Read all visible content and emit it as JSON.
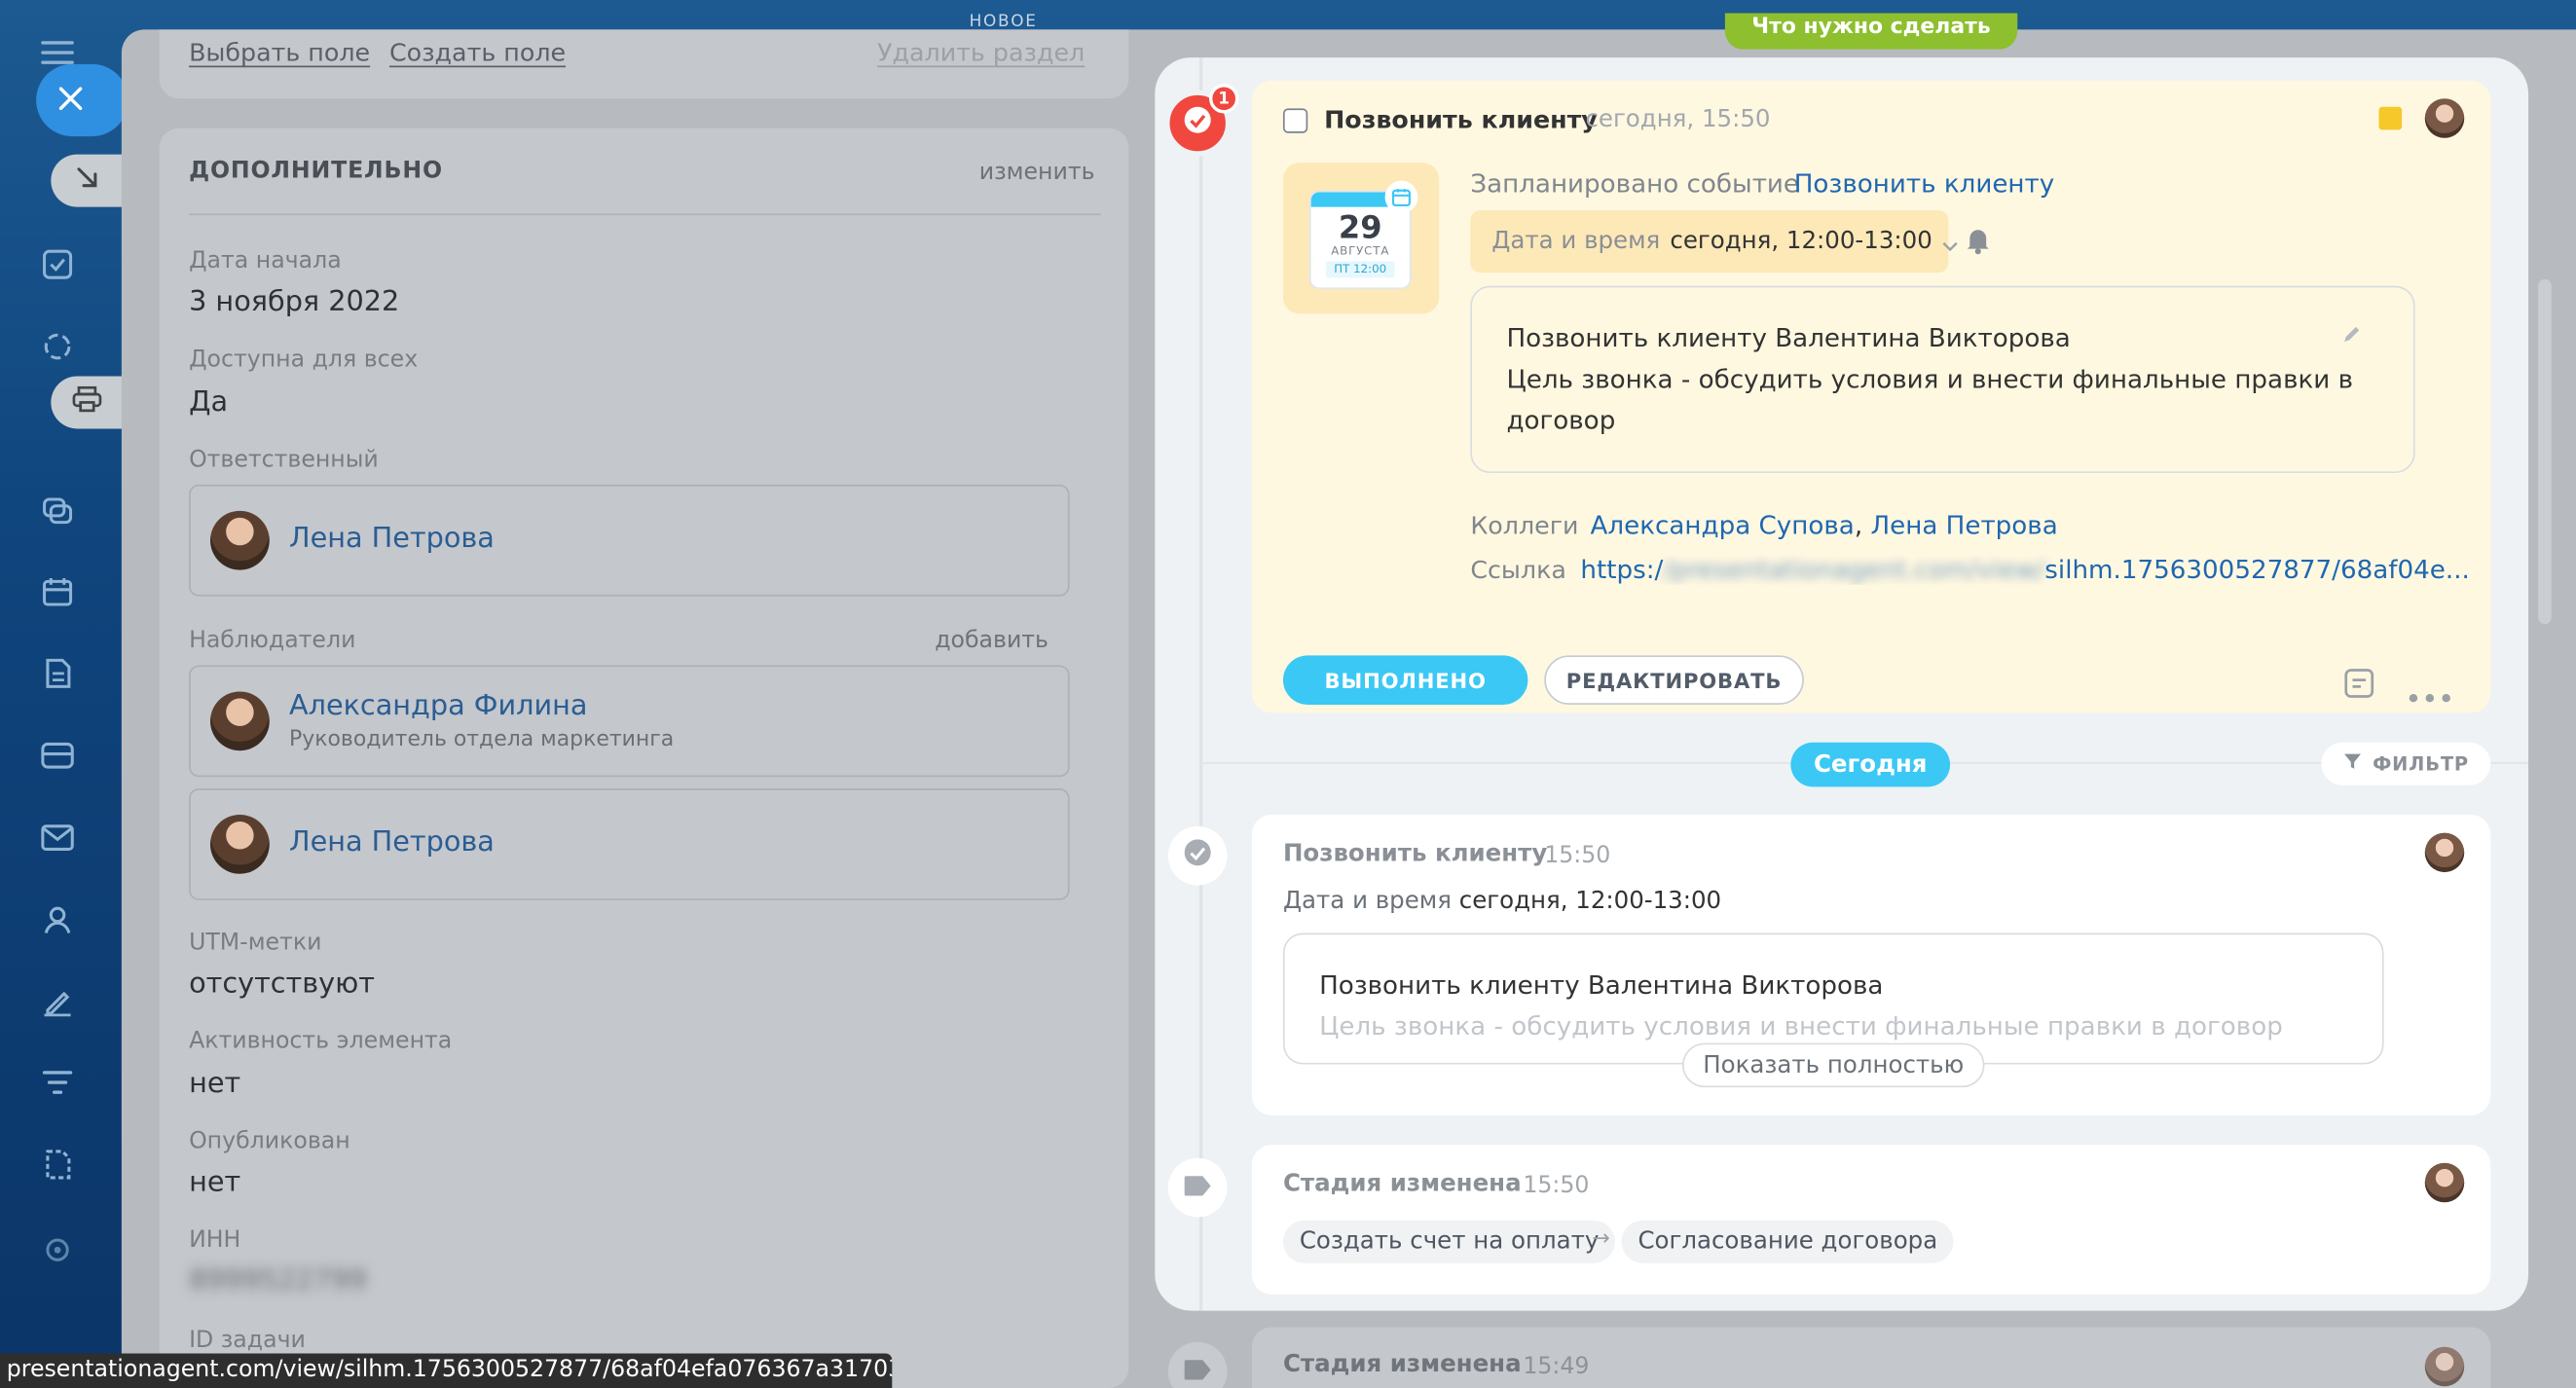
{
  "colors": {
    "accent": "#3bc8f5",
    "link": "#2067b0",
    "todo_pill": "#8dbf2e",
    "yellow_card": "#fff8e1",
    "badge": "#f0483e"
  },
  "top": {
    "new_label": "НОВОЕ",
    "todo_pill": "Что нужно сделать"
  },
  "left": {
    "select_field": "Выбрать поле",
    "create_field": "Создать поле",
    "delete_section": "Удалить раздел",
    "section_title": "ДОПОЛНИТЕЛЬНО",
    "edit_link": "изменить",
    "start_date_label": "Дата начала",
    "start_date_value": "3 ноября 2022",
    "available_label": "Доступна для всех",
    "available_value": "Да",
    "responsible_label": "Ответственный",
    "responsible_name": "Лена Петрова",
    "observers_label": "Наблюдатели",
    "add_link": "добавить",
    "observers": [
      {
        "name": "Александра Филина",
        "role": "Руководитель отдела маркетинга"
      },
      {
        "name": "Лена Петрова",
        "role": ""
      }
    ],
    "utm_label": "UTM-метки",
    "utm_value": "отсутствуют",
    "activity_label": "Активность элемента",
    "activity_value": "нет",
    "published_label": "Опубликован",
    "published_value": "нет",
    "inn_label": "ИНН",
    "inn_value": "8999522799",
    "task_id_label": "ID задачи"
  },
  "activity": {
    "badge": "1",
    "title": "Позвонить клиенту",
    "time": "сегодня, 15:50",
    "calendar": {
      "day": "29",
      "month": "АВГУСТА",
      "weekday": "ПТ 12:00"
    },
    "scheduled_label": "Запланировано событие",
    "scheduled_link": "Позвонить клиенту",
    "datetime_label": "Дата и время",
    "datetime_value": "сегодня, 12:00-13:00",
    "desc_line1": "Позвонить клиенту Валентина Викторова",
    "desc_line2": "Цель звонка - обсудить условия и внести финальные правки в",
    "desc_line3": "договор",
    "colleagues_label": "Коллеги",
    "colleague1": "Александра Супова",
    "colleague2": "Лена Петрова",
    "link_label": "Ссылка",
    "link_start": "https:/",
    "link_blurred": "/presentationagent.com/view/",
    "link_end": "silhm.1756300527877/68af04e...",
    "done_btn": "ВЫПОЛНЕНО",
    "edit_btn": "РЕДАКТИРОВАТЬ"
  },
  "divider": {
    "today": "Сегодня",
    "filter": "ФИЛЬТР"
  },
  "history": [
    {
      "title": "Позвонить клиенту",
      "time": "15:50",
      "datetime_label": "Дата и время",
      "datetime_value": "сегодня, 12:00-13:00",
      "desc_line1": "Позвонить клиенту Валентина Викторова",
      "desc_line2": "Цель звонка - обсудить условия и внести финальные правки в договор",
      "show_full": "Показать полностью"
    },
    {
      "title": "Стадия изменена",
      "time": "15:50",
      "from_stage": "Создать счет на оплату",
      "arrow": "→",
      "to_stage": "Согласование договора"
    },
    {
      "title": "Стадия изменена",
      "time": "15:49"
    }
  ],
  "status_url": "presentationagent.com/view/silhm.1756300527877/68af04efa076367a31703..."
}
